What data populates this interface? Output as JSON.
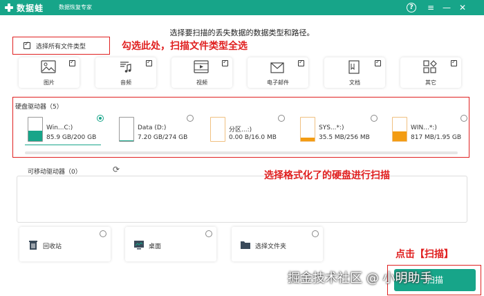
{
  "app": {
    "name": "数据蛙",
    "subtitle": "数据恢复专家",
    "accent": "#17a589",
    "help_glyph": "?",
    "menu_glyph": "≡",
    "min_glyph": "—",
    "close_glyph": "✕"
  },
  "instruction": "选择要扫描的丢失数据的数据类型和路径。",
  "select_all": {
    "label": "选择所有文件类型",
    "checked": true
  },
  "annotations": {
    "select_all_hint": "勾选此处，扫描文件类型全选",
    "drive_hint": "选择格式化了的硬盘进行扫描",
    "scan_hint": "点击【扫描】",
    "color": "#e02020"
  },
  "file_types": [
    {
      "label": "图片",
      "icon": "image-icon",
      "checked": true
    },
    {
      "label": "音频",
      "icon": "music-icon",
      "checked": true
    },
    {
      "label": "视频",
      "icon": "video-icon",
      "checked": true
    },
    {
      "label": "电子邮件",
      "icon": "email-icon",
      "checked": true
    },
    {
      "label": "文档",
      "icon": "document-icon",
      "checked": true
    },
    {
      "label": "其它",
      "icon": "other-icon",
      "checked": true
    }
  ],
  "hard_drives": {
    "title": "硬盘驱动器（5）",
    "drives": [
      {
        "name": "Win...C:)",
        "size": "85.9 GB/200 GB",
        "used_fraction": 0.43,
        "fill": "#17a589",
        "selected": true
      },
      {
        "name": "Data (D:)",
        "size": "7.20 GB/274 GB",
        "used_fraction": 0.03,
        "fill": "#17a589",
        "selected": false
      },
      {
        "name": "分区...:)",
        "size": "0.00  B/16.0 MB",
        "used_fraction": 0.0,
        "fill": "#f39c12",
        "selected": false
      },
      {
        "name": "SYS...*:)",
        "size": "35.5 MB/256 MB",
        "used_fraction": 0.14,
        "fill": "#f39c12",
        "selected": false
      },
      {
        "name": "WIN...*:)",
        "size": "817 MB/1.95 GB",
        "used_fraction": 0.42,
        "fill": "#f39c12",
        "selected": false
      }
    ]
  },
  "removable": {
    "title": "可移动驱动器（0）"
  },
  "locations": [
    {
      "label": "回收站",
      "icon": "recycle-bin-icon"
    },
    {
      "label": "桌面",
      "icon": "desktop-icon"
    },
    {
      "label": "选择文件夹",
      "icon": "folder-icon"
    }
  ],
  "scan_button": {
    "label": "扫描"
  },
  "watermark": "掘金技术社区 @ 小明助手"
}
